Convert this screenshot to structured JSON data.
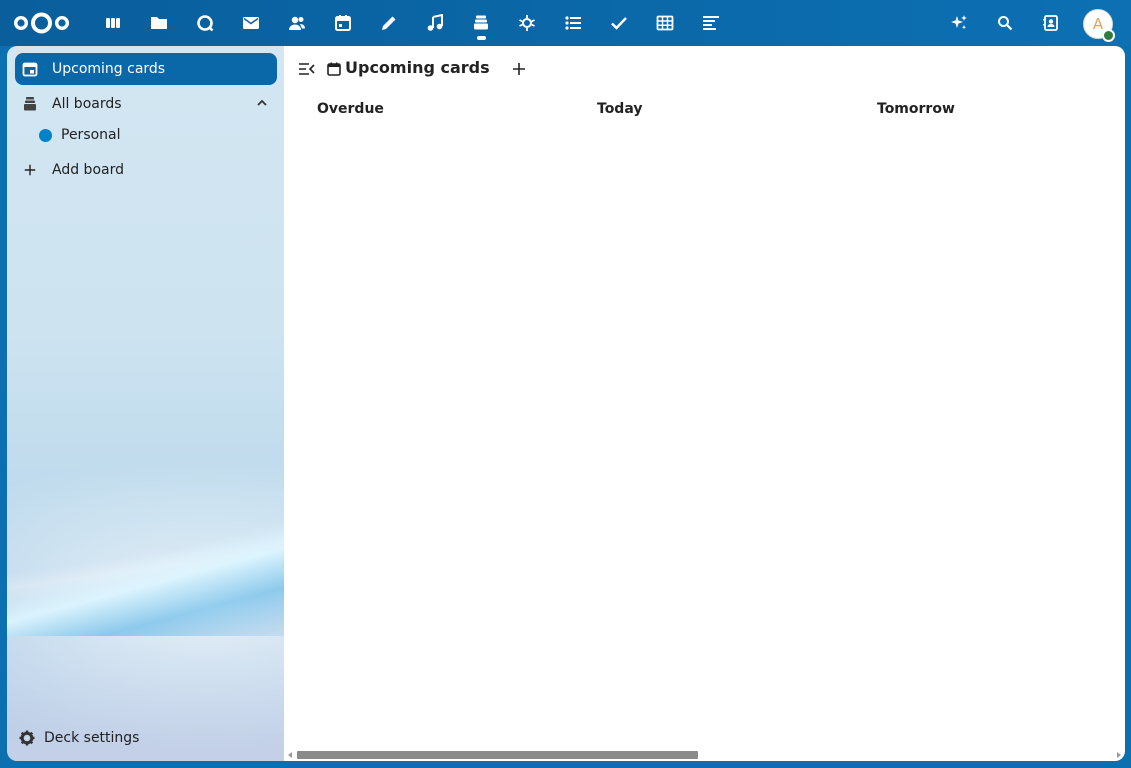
{
  "header": {
    "logo": "nextcloud-logo",
    "apps": [
      {
        "icon": "dashboard-icon",
        "label": "Dashboard"
      },
      {
        "icon": "files-icon",
        "label": "Files"
      },
      {
        "icon": "talk-icon",
        "label": "Talk"
      },
      {
        "icon": "mail-icon",
        "label": "Mail"
      },
      {
        "icon": "contacts-icon",
        "label": "Contacts"
      },
      {
        "icon": "calendar-icon",
        "label": "Calendar"
      },
      {
        "icon": "notes-icon",
        "label": "Notes"
      },
      {
        "icon": "music-icon",
        "label": "Music"
      },
      {
        "icon": "deck-icon",
        "label": "Deck",
        "active": true
      },
      {
        "icon": "assistant-icon",
        "label": "Assistant"
      },
      {
        "icon": "tasks-list-icon",
        "label": "Tasks"
      },
      {
        "icon": "checkmark-icon",
        "label": "Forms"
      },
      {
        "icon": "table-icon",
        "label": "Tables"
      },
      {
        "icon": "activity-icon",
        "label": "Activity"
      }
    ],
    "right_icons": [
      "sparkle-icon",
      "search-icon",
      "contacts-menu-icon"
    ],
    "avatar_initial": "A",
    "status_color": "#2d7b41"
  },
  "sidebar": {
    "upcoming_label": "Upcoming cards",
    "all_boards_label": "All boards",
    "boards": [
      {
        "label": "Personal",
        "color": "#0082c9"
      }
    ],
    "add_board_label": "Add board",
    "settings_label": "Deck settings"
  },
  "main": {
    "title": "Upcoming cards",
    "columns": [
      "Overdue",
      "Today",
      "Tomorrow"
    ]
  },
  "colors": {
    "header_bg": "#0b69aa",
    "accent": "#0a68a8"
  }
}
